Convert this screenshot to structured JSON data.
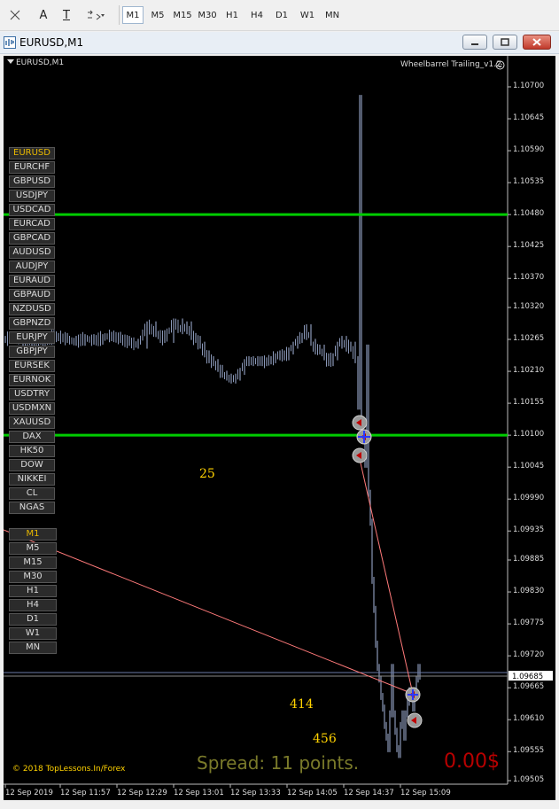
{
  "toolbar": {
    "text_tool": "A",
    "label_tool": "T",
    "timeframes": [
      "M1",
      "M5",
      "M15",
      "M30",
      "H1",
      "H4",
      "D1",
      "W1",
      "MN"
    ],
    "active_timeframe": "M1"
  },
  "window": {
    "title": "EURUSD,M1"
  },
  "chart": {
    "header": "EURUSD,M1",
    "indicator": "Wheelbarrel Trailing_v1.2",
    "symbols": [
      "EURUSD",
      "EURCHF",
      "GBPUSD",
      "USDJPY",
      "USDCAD",
      "EURCAD",
      "GBPCAD",
      "AUDUSD",
      "AUDJPY",
      "EURAUD",
      "GBPAUD",
      "NZDUSD",
      "GBPNZD",
      "EURJPY",
      "GBPJPY",
      "EURSEK",
      "EURNOK",
      "USDTRY",
      "USDMXN",
      "XAUUSD",
      "DAX",
      "HK50",
      "DOW",
      "NIKKEI",
      "CL",
      "NGAS"
    ],
    "selected_symbol": "EURUSD",
    "timeframes": [
      "M1",
      "M5",
      "M15",
      "M30",
      "H1",
      "H4",
      "D1",
      "W1",
      "MN"
    ],
    "selected_timeframe": "M1",
    "numbers": {
      "n25": "25",
      "n414": "414",
      "n456": "456"
    },
    "copyright": "© 2018 TopLessons.In/Forex",
    "spread": "Spread: 11 points.",
    "profit": "0.00$",
    "colors": {
      "bg": "#000000",
      "candles": "#8a98b8",
      "green_line": "#00cc00",
      "spread": "#7a7a2a",
      "profit": "#b80000",
      "trend": "#ff7a7a"
    }
  },
  "chart_data": {
    "type": "line",
    "title": "EURUSD,M1",
    "price_axis": [
      "1.10700",
      "1.10645",
      "1.10590",
      "1.10535",
      "1.10480",
      "1.10425",
      "1.10370",
      "1.10320",
      "1.10265",
      "1.10210",
      "1.10155",
      "1.10100",
      "1.10045",
      "1.09990",
      "1.09935",
      "1.09885",
      "1.09830",
      "1.09775",
      "1.09720",
      "1.09665",
      "1.09610",
      "1.09555",
      "1.09505"
    ],
    "time_axis": [
      "12 Sep 2019",
      "12 Sep 11:57",
      "12 Sep 12:29",
      "12 Sep 13:01",
      "12 Sep 13:33",
      "12 Sep 14:05",
      "12 Sep 14:37",
      "12 Sep 15:09"
    ],
    "current_price": "1.09685",
    "horizontal_lines": [
      1.1048,
      1.101
    ],
    "ylim": [
      1.09505,
      1.107
    ],
    "series": [
      {
        "name": "",
        "x": [
          0,
          10,
          20,
          30,
          40,
          50,
          60,
          70,
          80,
          90,
          100,
          110,
          120,
          130,
          140,
          150,
          160,
          170,
          180,
          190,
          200,
          205,
          210,
          215,
          220,
          225,
          230,
          235,
          240,
          245,
          250,
          255,
          260,
          265,
          270,
          275,
          280,
          285,
          290,
          295,
          300,
          305,
          310,
          315,
          320,
          325,
          330,
          335,
          340,
          345,
          350,
          355,
          360,
          365,
          370,
          375,
          380,
          385,
          390,
          395,
          398,
          400,
          402,
          404,
          406,
          408,
          410,
          412,
          414,
          416,
          418,
          420,
          422,
          424,
          426,
          428,
          430,
          432,
          434,
          436,
          438,
          440,
          442,
          444,
          446,
          448,
          450,
          452,
          454,
          456,
          458,
          460,
          462,
          464,
          466,
          468
        ],
        "values": [
          1.10265,
          1.1027,
          1.1026,
          1.10265,
          1.10262,
          1.10268,
          1.1027,
          1.10265,
          1.1026,
          1.10268,
          1.10262,
          1.10268,
          1.10272,
          1.10265,
          1.1026,
          1.10255,
          1.1029,
          1.10275,
          1.10265,
          1.10295,
          1.1028,
          1.1029,
          1.1027,
          1.10265,
          1.10255,
          1.1024,
          1.1023,
          1.10225,
          1.10215,
          1.10205,
          1.102,
          1.10195,
          1.102,
          1.1021,
          1.10225,
          1.1023,
          1.10225,
          1.1023,
          1.10225,
          1.10228,
          1.1023,
          1.10235,
          1.1024,
          1.10235,
          1.10245,
          1.10255,
          1.10265,
          1.1027,
          1.10285,
          1.1026,
          1.10245,
          1.1025,
          1.10235,
          1.10225,
          1.10235,
          1.10255,
          1.10265,
          1.1025,
          1.10255,
          1.1023,
          1.1015,
          1.1068,
          1.1011,
          1.101,
          1.1005,
          1.1025,
          1.1,
          1.0995,
          1.0985,
          1.098,
          1.0974,
          1.097,
          1.0968,
          1.0965,
          1.0963,
          1.096,
          1.0958,
          1.0956,
          1.0962,
          1.097,
          1.0962,
          1.0959,
          1.0956,
          1.0955,
          1.096,
          1.0962,
          1.0958,
          1.0962,
          1.0964,
          1.0966,
          1.0965,
          1.0963,
          1.0966,
          1.0968,
          1.097,
          1.09685
        ]
      }
    ]
  }
}
